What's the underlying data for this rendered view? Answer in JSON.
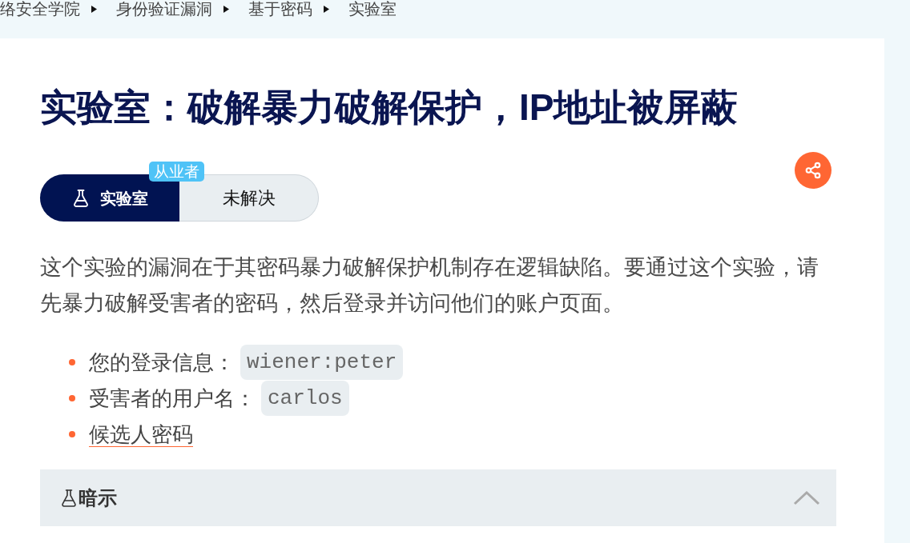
{
  "breadcrumb": [
    "络安全学院",
    "身份验证漏洞",
    "基于密码",
    "实验室"
  ],
  "title": "实验室：破解暴力破解保护，IP地址被屏蔽",
  "lab_tag": {
    "tier": "从业者",
    "label": "实验室",
    "status": "未解决"
  },
  "description": "这个实验的漏洞在于其密码暴力破解保护机制存在逻辑缺陷。要通过这个实验，请先暴力破解受害者的密码，然后登录并访问他们的账户页面。",
  "details": [
    {
      "kind": "code",
      "label": "您的登录信息：",
      "code": "wiener:peter"
    },
    {
      "kind": "code",
      "label": "受害者的用户名：",
      "code": "carlos"
    },
    {
      "kind": "link",
      "label": "候选人密码"
    }
  ],
  "hint": {
    "label": "暗示"
  }
}
